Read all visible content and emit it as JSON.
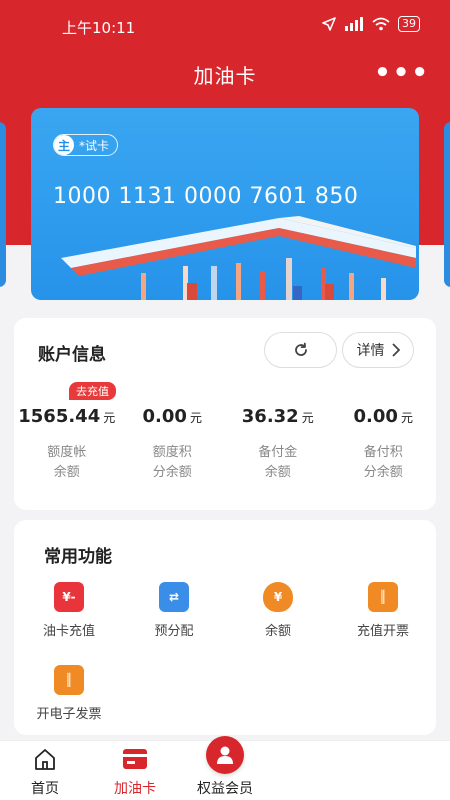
{
  "status": {
    "time": "上午10:11",
    "battery": "39"
  },
  "header": {
    "title": "加油卡",
    "more_label": "•••"
  },
  "card": {
    "badge_main": "主",
    "badge_name": "*试卡",
    "number": "1000 1131 0000 7601 850"
  },
  "account": {
    "title": "账户信息",
    "detail_label": "详情",
    "recharge_tag": "去充值",
    "items": [
      {
        "value": "1565.44",
        "unit": "元",
        "label_line1": "额度帐",
        "label_line2": "余额"
      },
      {
        "value": "0.00",
        "unit": "元",
        "label_line1": "额度积",
        "label_line2": "分余额"
      },
      {
        "value": "36.32",
        "unit": "元",
        "label_line1": "备付金",
        "label_line2": "余额"
      },
      {
        "value": "0.00",
        "unit": "元",
        "label_line1": "备付积",
        "label_line2": "分余额"
      }
    ]
  },
  "functions": {
    "title": "常用功能",
    "items": [
      {
        "label": "油卡充值",
        "icon": "card-recharge-icon",
        "color": "#e8343a"
      },
      {
        "label": "预分配",
        "icon": "transfer-icon",
        "color": "#3a8ee8"
      },
      {
        "label": "余额",
        "icon": "money-bag-icon",
        "color": "#f08a24"
      },
      {
        "label": "充值开票",
        "icon": "ticket-icon",
        "color": "#f08a24"
      },
      {
        "label": "开电子发票",
        "icon": "e-ticket-icon",
        "color": "#f08a24"
      }
    ]
  },
  "tabbar": {
    "items": [
      {
        "label": "首页",
        "icon": "home-icon"
      },
      {
        "label": "加油卡",
        "icon": "fuel-card-icon"
      },
      {
        "label": "权益会员",
        "icon": "member-icon"
      }
    ]
  },
  "colors": {
    "brand_red": "#d8262d",
    "card_blue": "#2b98ec"
  }
}
